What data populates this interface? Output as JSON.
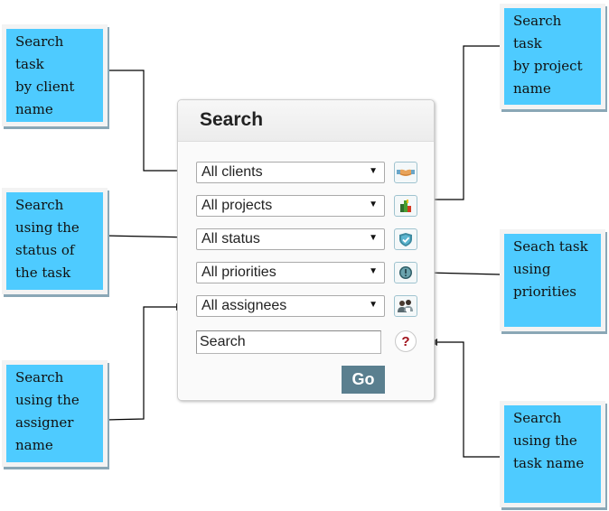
{
  "panel": {
    "title": "Search",
    "filters": [
      {
        "label": "All clients",
        "icon": "handshake-icon"
      },
      {
        "label": "All projects",
        "icon": "bar-chart-icon"
      },
      {
        "label": "All status",
        "icon": "shield-check-icon"
      },
      {
        "label": "All priorities",
        "icon": "exclamation-circle-icon"
      },
      {
        "label": "All assignees",
        "icon": "people-icon"
      }
    ],
    "search_value": "Search",
    "help_glyph": "?",
    "go_label": "Go",
    "dropdown_glyph": "▼"
  },
  "callouts": {
    "client": "Search task\nby client\nname",
    "project": "Search task\nby project\nname",
    "status": "Search\nusing the\nstatus of\nthe task",
    "priorities": "Seach task\nusing\npriorities",
    "assigner": "Search\nusing the\nassigner\nname",
    "task_name": "Search\nusing the\ntask name"
  },
  "colors": {
    "callout_fill": "#4ecbff",
    "go_button": "#5a7f8f"
  }
}
